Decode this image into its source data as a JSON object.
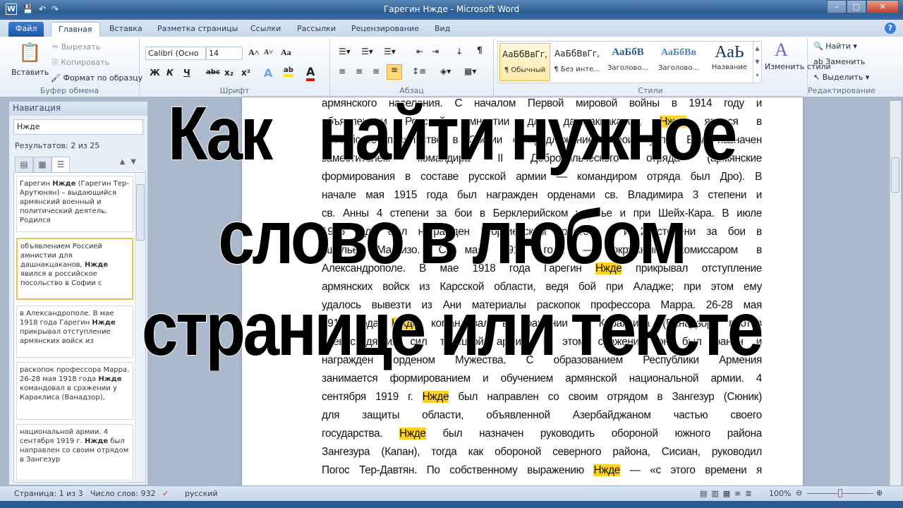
{
  "window": {
    "title": "Гарегин Нжде - Microsoft Word",
    "app_icon": "word-icon",
    "minimize": "–",
    "maximize": "□",
    "close": "✕"
  },
  "qat": {
    "save": "save-icon",
    "undo": "↶",
    "redo": "↷"
  },
  "tabs": [
    {
      "label": "Файл"
    },
    {
      "label": "Главная"
    },
    {
      "label": "Вставка"
    },
    {
      "label": "Разметка страницы"
    },
    {
      "label": "Ссылки"
    },
    {
      "label": "Рассылки"
    },
    {
      "label": "Рецензирование"
    },
    {
      "label": "Вид"
    }
  ],
  "active_tab": "Главная",
  "ribbon": {
    "clipboard": {
      "label": "Буфер обмена",
      "paste": "Вставить",
      "cut": "Вырезать",
      "copy": "Копировать",
      "format_painter": "Формат по образцу"
    },
    "font": {
      "label": "Шрифт",
      "font_name": "Calibri (Осно",
      "font_size": "14",
      "bold": "Ж",
      "italic": "К",
      "underline": "Ч",
      "strike": "abc",
      "sub": "x₂",
      "sup": "x²",
      "grow": "A˄",
      "shrink": "A˅",
      "case": "Aa"
    },
    "paragraph": {
      "label": "Абзац",
      "pilcrow": "¶"
    },
    "styles": {
      "label": "Стили",
      "items": [
        {
          "sample": "АаБбВвГг,",
          "name": "¶ Обычный",
          "selected": true
        },
        {
          "sample": "АаБбВвГг,",
          "name": "¶ Без инте..."
        },
        {
          "sample": "АаБбВ",
          "name": "Заголово..."
        },
        {
          "sample": "АаБбВв",
          "name": "Заголово..."
        },
        {
          "sample": "АаЬ",
          "name": "Название"
        }
      ],
      "change_styles": "Изменить стили"
    },
    "editing": {
      "label": "Редактирование",
      "find": "Найти",
      "replace": "Заменить",
      "select": "Выделить"
    }
  },
  "navigation": {
    "title": "Навигация",
    "search_value": "Нжде",
    "results": "Результатов: 2 из 25",
    "items": [
      {
        "pre": "Гарегин ",
        "hl": "Нжде",
        "post": " (Гарегин Тер-Арутюнян) – выдающийся армянский военный и политический деятель. Родился"
      },
      {
        "pre": "объявлением Россией амнистии для дашнакцаканов, ",
        "hl": "Нжде",
        "post": " явился в российское посольство в Софии с",
        "current": true
      },
      {
        "pre": "в Александрополе. В мае 1918 года Гарегин ",
        "hl": "Нжде",
        "post": " прикрывал отступление армянских войск из"
      },
      {
        "pre": "раскопок профессора Марра. 26-28 мая 1918 года ",
        "hl": "Нжде",
        "post": " командовал в сражении у Караклиса (Ванадзор),"
      },
      {
        "pre": "национальной армии. 4 сентября 1919 г. ",
        "hl": "Нжде",
        "post": " был направлен со своим отрядом в Зангезур"
      }
    ]
  },
  "document": {
    "highlight_color": "#ffd21f",
    "lines": [
      {
        "pre": "армянского населения. С началом Первой мировой войны в 1914 году и"
      },
      {
        "pre": "объявлением Россией амнистии для дашнакцаканов, ",
        "hl": "Нжде",
        "post": " явился в"
      },
      {
        "pre": "российское посольство в Софии с предложением своих услуг. Был назначен"
      },
      {
        "pre": "заместителем командира II Добровольческого отряда (армянские"
      },
      {
        "pre": "формирования в составе русской армии — командиром отряда был Дро). В"
      },
      {
        "pre": "начале мая 1915 года был награжден орденами св. Владимира 3 степени и"
      },
      {
        "pre": "св. Анны 4 степени за бои в Берклерийском ущелье и при Шейх-Кара. В июле"
      },
      {
        "pre": "1915 года был награжден Георгиевским крестом 3 и 2 степени за бои в"
      },
      {
        "pre": "ущелье Магризо. С мая 1917 года — окружным комиссаром в"
      },
      {
        "pre": "Александрополе. В мае 1918 года Гарегин ",
        "hl": "Нжде",
        "post": " прикрывал отступление"
      },
      {
        "pre": "армянских войск из Карсской области, ведя бой при Аладже; при этом ему"
      },
      {
        "pre": "удалось вывезти из Ани материалы раскопок профессора Марра. 26-28 мая"
      },
      {
        "pre": "1918 года ",
        "hl": "Нжде",
        "post": " командовал в сражении у Караклиса (Ванадзор) против"
      },
      {
        "pre": "превосходящих сил турецкой армии. В этом сражении он был ранен и"
      },
      {
        "pre": "награжден орденом Мужества. С образованием Республики Армения"
      },
      {
        "pre": "занимается формированием и обучением армянской национальной армии. 4"
      },
      {
        "pre": "сентября 1919 г. ",
        "hl": "Нжде",
        "post": " был направлен со своим отрядом в Зангезур (Сюник)"
      },
      {
        "pre": "для защиты области, объявленной Азербайджаном частью своего"
      },
      {
        "pre": "государства. ",
        "hl": "Нжде",
        "post": " был назначен руководить обороной южного района"
      },
      {
        "pre": "Зангезура (Капан), тогда как обороной северного района, Сисиан, руководил"
      },
      {
        "pre": "Погос Тер-Давтян. По собственному выражению ",
        "hl": "Нжде",
        "post": " — «с этого времени я"
      }
    ]
  },
  "overlay": {
    "line1": "Как   найти нужное",
    "line2": "слово в любом",
    "line3": "странице или тексте"
  },
  "status": {
    "page": "Страница: 1 из 3",
    "words": "Число слов: 932",
    "language": "русский",
    "zoom": "100%"
  }
}
